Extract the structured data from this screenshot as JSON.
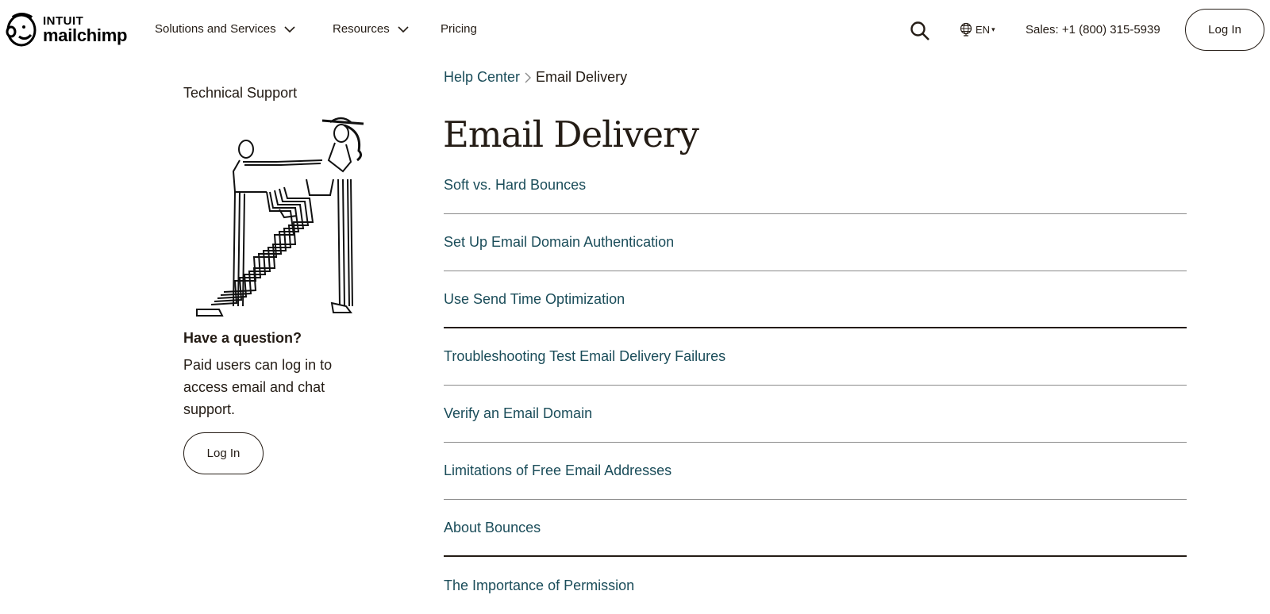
{
  "header": {
    "brand_top": "INTUIT",
    "brand_bottom": "mailchimp",
    "nav": [
      {
        "label": "Solutions and Services",
        "has_dropdown": true
      },
      {
        "label": "Resources",
        "has_dropdown": true
      },
      {
        "label": "Pricing",
        "has_dropdown": false
      }
    ],
    "language": "EN",
    "sales": "Sales: +1 (800) 315-5939",
    "login_label": "Log In"
  },
  "sidebar": {
    "title": "Technical Support",
    "question_title": "Have a question?",
    "question_text": "Paid users can log in to access email and chat support.",
    "login_label": "Log In"
  },
  "main": {
    "breadcrumb": {
      "home": "Help Center",
      "current": "Email Delivery"
    },
    "title": "Email Delivery",
    "articles": [
      "Soft vs. Hard Bounces",
      "Set Up Email Domain Authentication",
      "Use Send Time Optimization",
      "Troubleshooting Test Email Delivery Failures",
      "Verify an Email Domain",
      "Limitations of Free Email Addresses",
      "About Bounces",
      "The Importance of Permission"
    ]
  },
  "colors": {
    "text": "#241c15",
    "link": "#1b4d5a",
    "divider": "#8a8a8a"
  }
}
